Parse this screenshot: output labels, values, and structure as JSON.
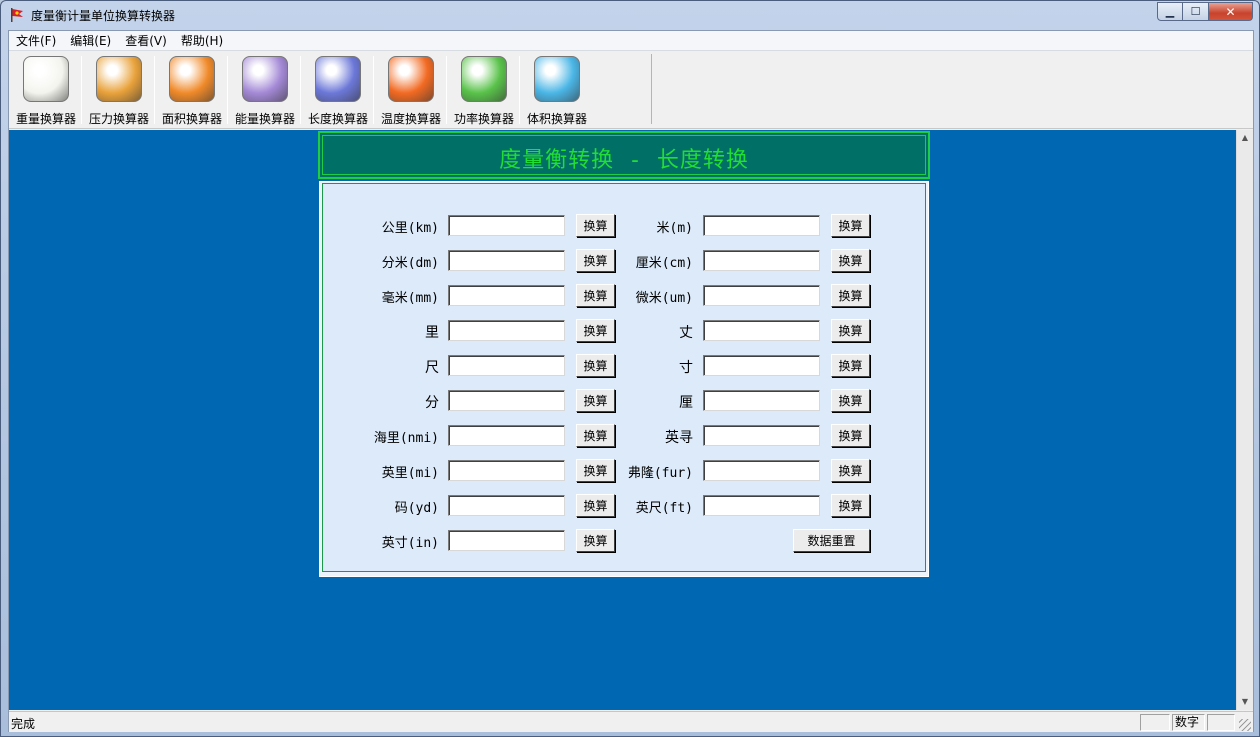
{
  "window": {
    "title": "度量衡计量单位换算转换器"
  },
  "window_buttons": {
    "minimize": "▁",
    "maximize": "☐",
    "close": "✕"
  },
  "menu": [
    "文件(F)",
    "编辑(E)",
    "查看(V)",
    "帮助(H)"
  ],
  "toolbar": [
    {
      "label": "重量换算器",
      "icon": "scale-icon",
      "color": "#f4f4ee"
    },
    {
      "label": "压力换算器",
      "icon": "people-icon",
      "color": "#e9a23b"
    },
    {
      "label": "面积换算器",
      "icon": "paper-icon",
      "color": "#f08a2a"
    },
    {
      "label": "能量换算器",
      "icon": "box-icon",
      "color": "#a489d6"
    },
    {
      "label": "长度换算器",
      "icon": "monitor-icon",
      "color": "#6c78d8"
    },
    {
      "label": "温度换算器",
      "icon": "robot-icon",
      "color": "#f26a22"
    },
    {
      "label": "功率换算器",
      "icon": "girl-icon",
      "color": "#59c24a"
    },
    {
      "label": "体积换算器",
      "icon": "balloon-icon",
      "color": "#4bb6e6"
    }
  ],
  "header": {
    "title": "度量衡转换 - 长度转换"
  },
  "form": {
    "convert_label": "换算",
    "reset_label": "数据重置",
    "left": [
      {
        "label": "公里(km)",
        "value": ""
      },
      {
        "label": "分米(dm)",
        "value": ""
      },
      {
        "label": "毫米(mm)",
        "value": ""
      },
      {
        "label": "里",
        "value": ""
      },
      {
        "label": "尺",
        "value": ""
      },
      {
        "label": "分",
        "value": ""
      },
      {
        "label": "海里(nmi)",
        "value": ""
      },
      {
        "label": "英里(mi)",
        "value": ""
      },
      {
        "label": "码(yd)",
        "value": ""
      },
      {
        "label": "英寸(in)",
        "value": ""
      }
    ],
    "right": [
      {
        "label": "米(m)",
        "value": ""
      },
      {
        "label": "厘米(cm)",
        "value": ""
      },
      {
        "label": "微米(um)",
        "value": ""
      },
      {
        "label": "丈",
        "value": ""
      },
      {
        "label": "寸",
        "value": ""
      },
      {
        "label": "厘",
        "value": ""
      },
      {
        "label": "英寻",
        "value": ""
      },
      {
        "label": "弗隆(fur)",
        "value": ""
      },
      {
        "label": "英尺(ft)",
        "value": ""
      }
    ]
  },
  "scrollbar": {
    "up": "▲",
    "down": "▼"
  },
  "status": {
    "text": "完成",
    "num_pane": "数字"
  }
}
